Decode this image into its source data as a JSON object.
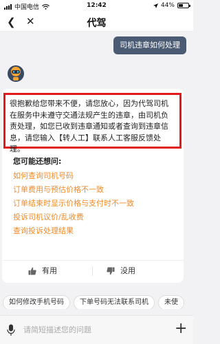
{
  "status_bar": {
    "carrier": "中国电信",
    "time": "12:42",
    "battery": "44%",
    "battery_level": 0.44
  },
  "nav": {
    "title": "代驾"
  },
  "chat": {
    "user_message": "司机违章如何处理",
    "bot_reply": "很抱歉给您带来不便，请您放心，因为代驾司机在服务中未遵守交通法规产生的违章，由司机负责处理，如您已收到违章通知或者查询到违章信息，请您输入【转人工】联系人工客服反馈处理。",
    "suggest_title": "您可能还想问:",
    "suggestions": [
      "如何查询司机号码",
      "订单费用与预估价格不一致",
      "订单结束时显示价格与支付时不一致",
      "投诉司机议价/乱收费",
      "查询投诉处理结果"
    ],
    "useful_label": "有用",
    "useless_label": "没用"
  },
  "quick_replies": [
    "如何修改手机号码",
    "下单号码无法联系司机",
    "未使"
  ],
  "input": {
    "placeholder": "请简短描述您的问题"
  },
  "colors": {
    "user_bubble": "#4a5b73",
    "suggestion": "#f08c2b",
    "highlight_border": "#e01919"
  }
}
